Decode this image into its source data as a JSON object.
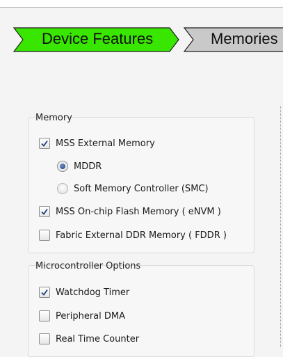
{
  "wizard": {
    "steps": [
      {
        "label": "Device Features",
        "active": true,
        "color": "#39e600"
      },
      {
        "label": "Memories",
        "active": false,
        "color": "#c9c9c9"
      }
    ]
  },
  "memory": {
    "title": "Memory",
    "mss_external": {
      "label": "MSS External Memory",
      "checked": true
    },
    "mddr": {
      "label": "MDDR",
      "selected": true
    },
    "smc": {
      "label": "Soft Memory Controller (SMC)",
      "selected": false
    },
    "envm": {
      "label": "MSS On-chip Flash Memory ( eNVM )",
      "checked": true
    },
    "fddr": {
      "label": "Fabric External DDR Memory ( FDDR )",
      "checked": false
    }
  },
  "micro": {
    "title": "Microcontroller Options",
    "watchdog": {
      "label": "Watchdog Timer",
      "checked": true
    },
    "pdma": {
      "label": "Peripheral DMA",
      "checked": false
    },
    "rtc": {
      "label": "Real Time Counter",
      "checked": false
    }
  },
  "colors": {
    "accent": "#39e600",
    "check": "#1f3f7f"
  }
}
